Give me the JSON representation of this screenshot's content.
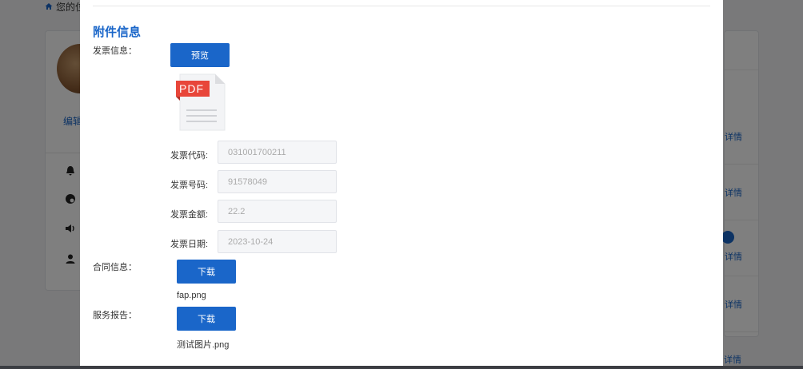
{
  "background": {
    "breadcrumb_text": "您的位",
    "edit_label": "编辑",
    "right_links": [
      "详情",
      "详情",
      "详情",
      "详情",
      "详情"
    ]
  },
  "modal": {
    "section_title": "附件信息",
    "invoice": {
      "label": "发票信息：",
      "preview_button": "预览",
      "file_icon": "pdf-file-icon",
      "pdf_badge": "PDF",
      "fields": [
        {
          "label": "发票代码:",
          "value": "031001700211"
        },
        {
          "label": "发票号码:",
          "value": "91578049"
        },
        {
          "label": "发票金额:",
          "value": "22.2"
        },
        {
          "label": "发票日期:",
          "value": "2023-10-24"
        }
      ]
    },
    "contract": {
      "label": "合同信息：",
      "download_button": "下载",
      "file_name": "fap.png"
    },
    "report": {
      "label": "服务报告：",
      "download_button": "下载",
      "file_name": "测试图片.png"
    }
  },
  "colors": {
    "accent": "#1a66c9",
    "pdf_red": "#e8463a"
  }
}
